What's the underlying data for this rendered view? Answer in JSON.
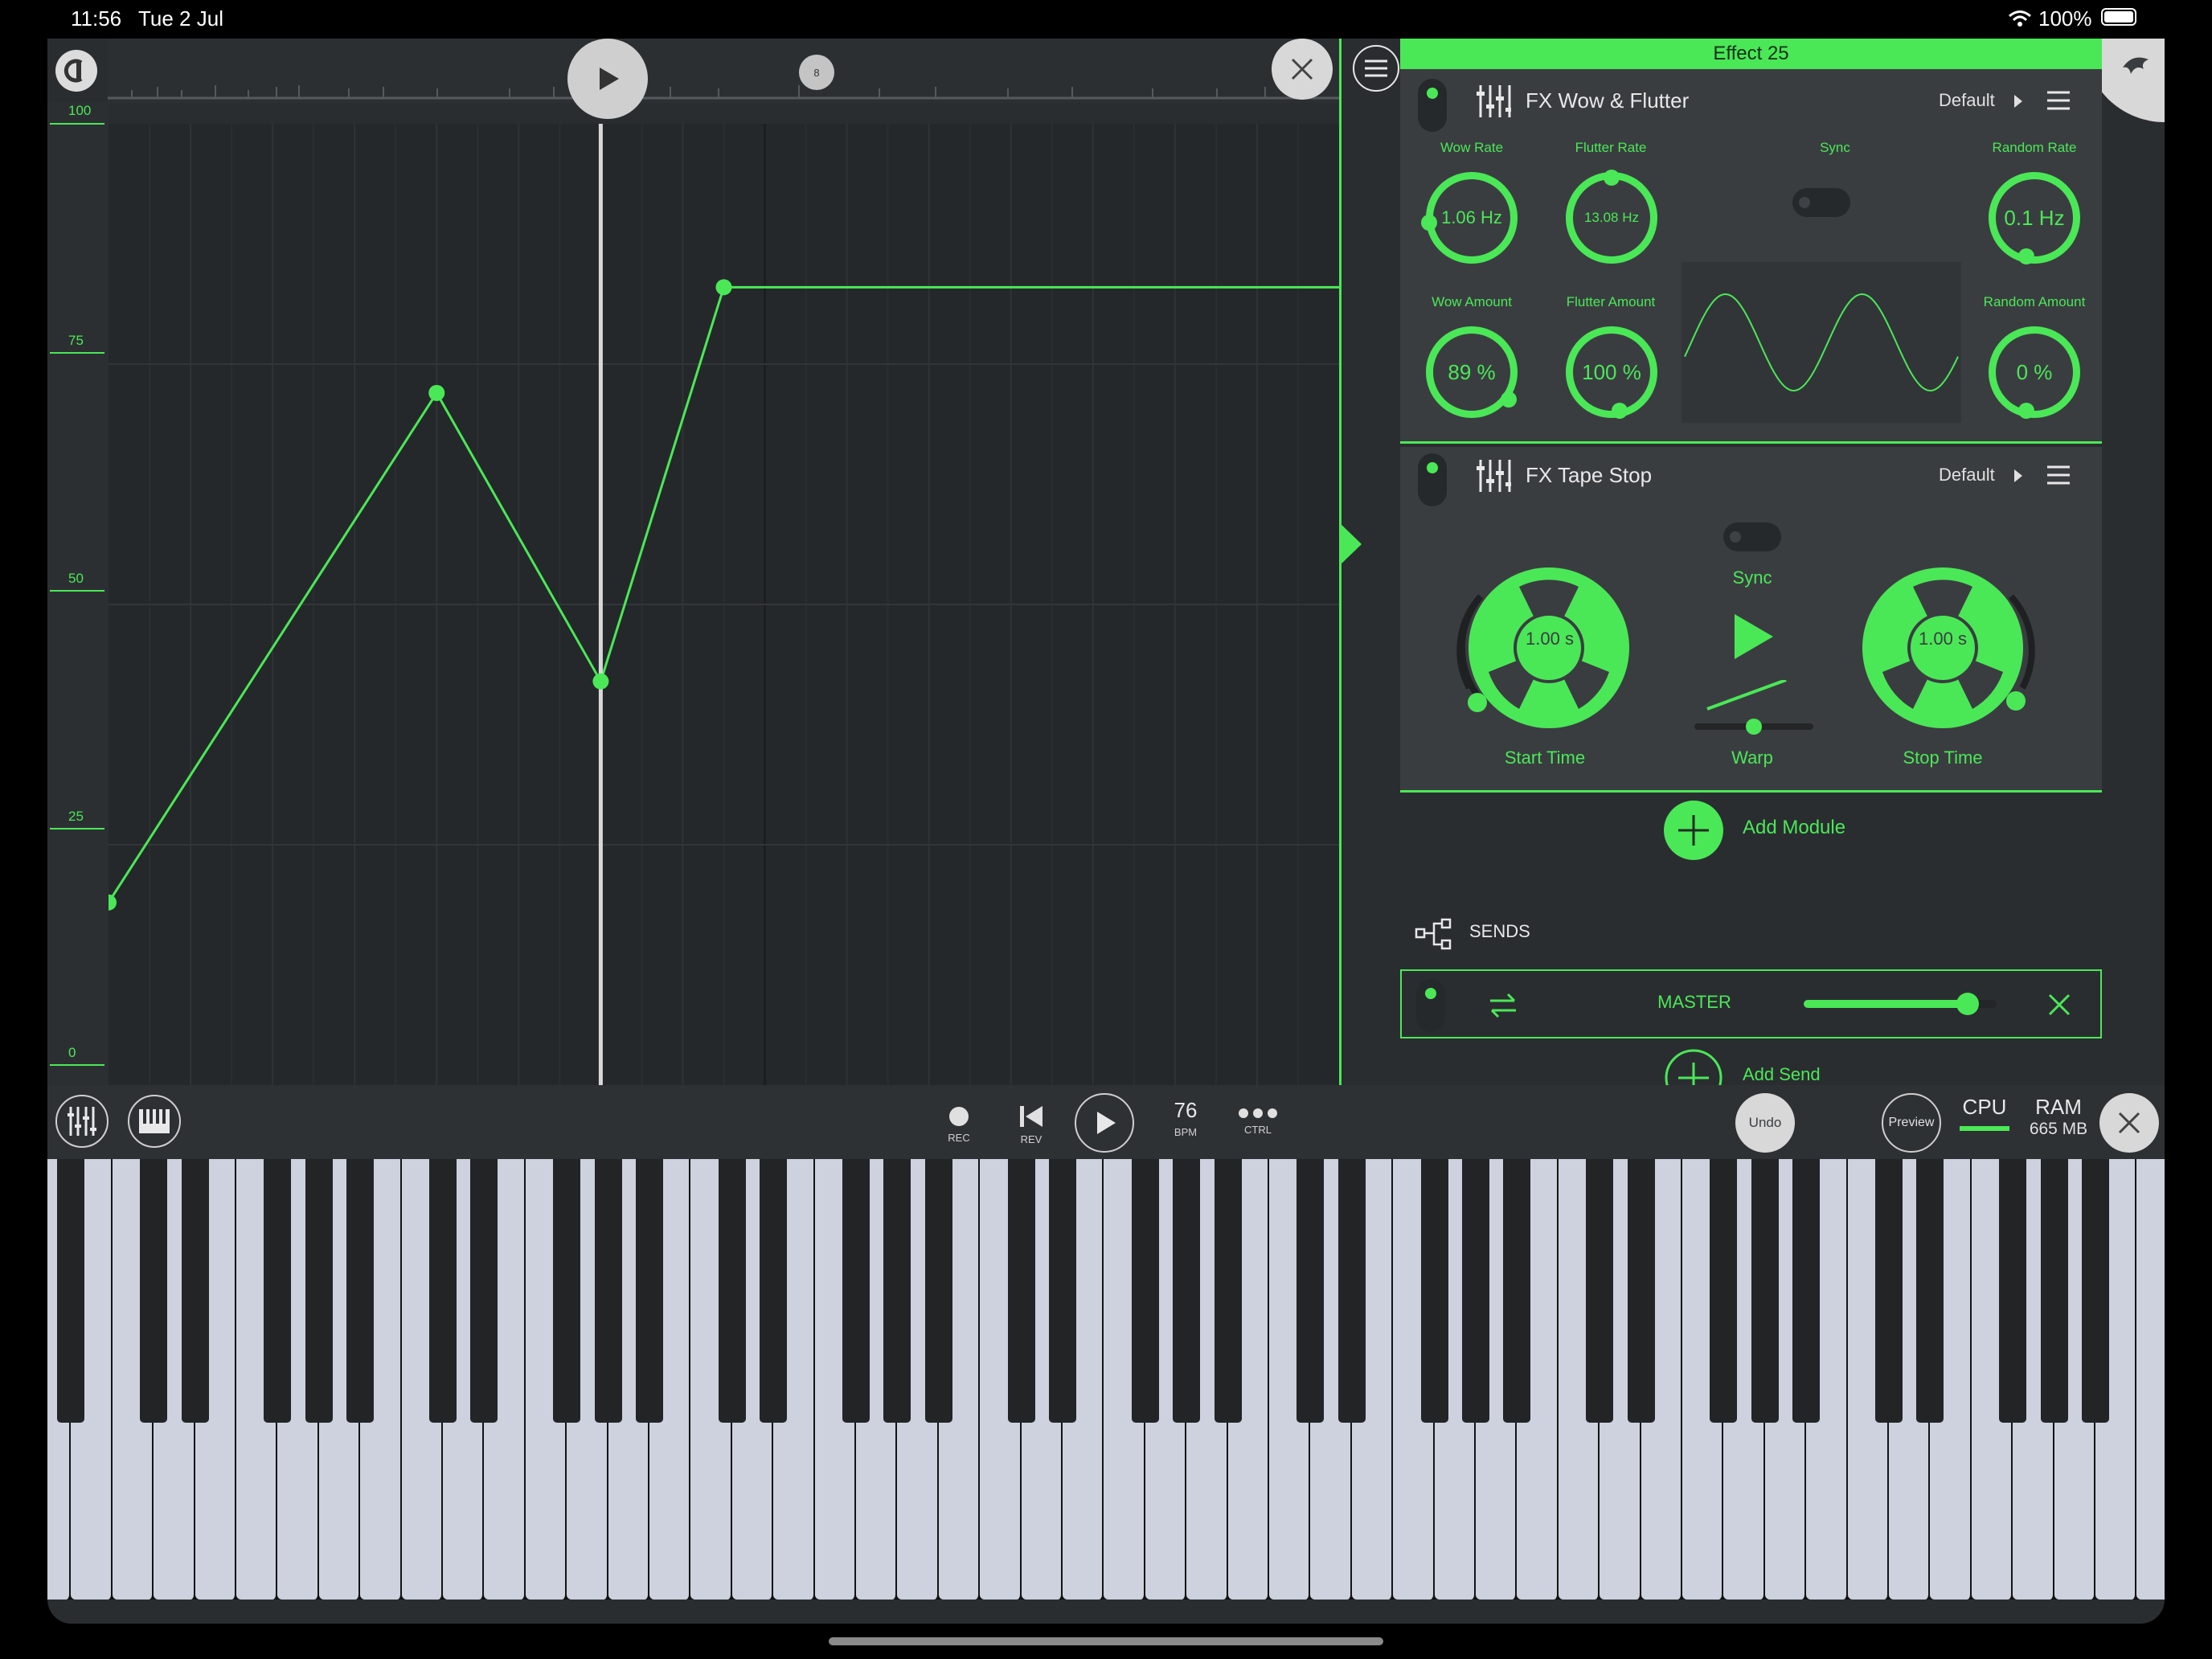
{
  "status_bar": {
    "time": "11:56",
    "date": "Tue 2 Jul",
    "battery": "100%"
  },
  "automation": {
    "scale_labels": [
      "100",
      "75",
      "50",
      "25",
      "0"
    ],
    "marker_label": "8",
    "points": [
      {
        "beat": 0.0,
        "value": 19
      },
      {
        "beat": 4.0,
        "value": 72
      },
      {
        "beat": 6.0,
        "value": 42
      },
      {
        "beat": 7.5,
        "value": 83
      },
      {
        "beat": 15.0,
        "value": 83
      }
    ],
    "playhead_beat": 6.0
  },
  "effect": {
    "title": "Effect 25",
    "modules": [
      {
        "name": "FX Wow & Flutter",
        "preset": "Default",
        "knobs": {
          "wow_rate": {
            "label": "Wow Rate",
            "value": "1.06 Hz"
          },
          "flutter_rate": {
            "label": "Flutter Rate",
            "value": "13.08 Hz"
          },
          "sync": {
            "label": "Sync"
          },
          "random_rate": {
            "label": "Random Rate",
            "value": "0.1 Hz"
          },
          "wow_amount": {
            "label": "Wow Amount",
            "value": "89 %"
          },
          "flutter_amount": {
            "label": "Flutter Amount",
            "value": "100 %"
          },
          "random_amount": {
            "label": "Random Amount",
            "value": "0 %"
          }
        }
      },
      {
        "name": "FX Tape Stop",
        "preset": "Default",
        "start_time": {
          "label": "Start Time",
          "value": "1.00 s"
        },
        "stop_time": {
          "label": "Stop Time",
          "value": "1.00 s"
        },
        "sync_label": "Sync",
        "warp_label": "Warp"
      }
    ],
    "add_module": "Add Module",
    "sends_label": "SENDS",
    "send": {
      "name": "MASTER",
      "level": 0.85
    },
    "add_send": "Add Send"
  },
  "transport": {
    "rec": "REC",
    "rev": "REV",
    "bpm_value": "76",
    "bpm": "BPM",
    "ctrl": "CTRL",
    "undo": "Undo",
    "preview": "Preview",
    "cpu": "CPU",
    "ram": "RAM",
    "ram_value": "665 MB"
  },
  "colors": {
    "accent": "#4ae857",
    "background": "#2a2d30",
    "panel": "#3a3d40"
  }
}
